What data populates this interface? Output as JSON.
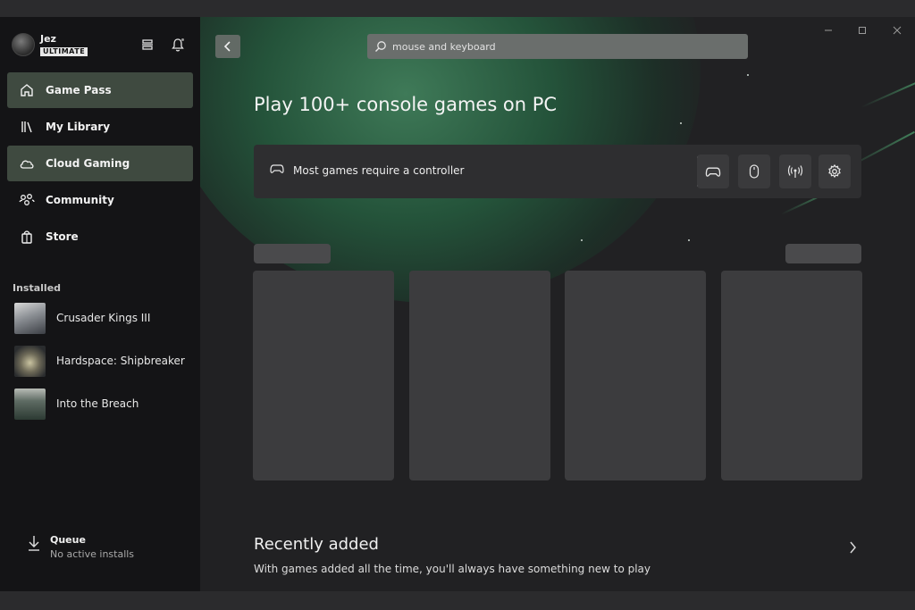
{
  "profile": {
    "gamertag": "Jez",
    "tier": "ULTIMATE"
  },
  "nav": [
    {
      "label": "Game Pass",
      "icon": "home-icon",
      "active": true
    },
    {
      "label": "My Library",
      "icon": "library-icon",
      "active": false
    },
    {
      "label": "Cloud Gaming",
      "icon": "cloud-icon",
      "active": true
    },
    {
      "label": "Community",
      "icon": "community-icon",
      "active": false
    },
    {
      "label": "Store",
      "icon": "store-bag-icon",
      "active": false
    }
  ],
  "installed": {
    "label": "Installed",
    "items": [
      {
        "title": "Crusader Kings III"
      },
      {
        "title": "Hardspace: Shipbreaker"
      },
      {
        "title": "Into the Breach"
      }
    ]
  },
  "queue": {
    "title": "Queue",
    "status": "No active installs"
  },
  "search": {
    "placeholder": "mouse and keyboard"
  },
  "hero": {
    "title": "Play 100+ console games on PC"
  },
  "controller_bar": {
    "label": "Most games require a controller",
    "buttons": [
      "controller-icon",
      "mouse-icon",
      "broadcast-icon",
      "settings-gear-icon"
    ]
  },
  "recent": {
    "title": "Recently added",
    "subtitle": "With games added all the time, you'll always have something new to play"
  },
  "colors": {
    "accent_green": "#3f4a40",
    "sidebar_bg": "#141416",
    "main_bg": "#212123"
  }
}
